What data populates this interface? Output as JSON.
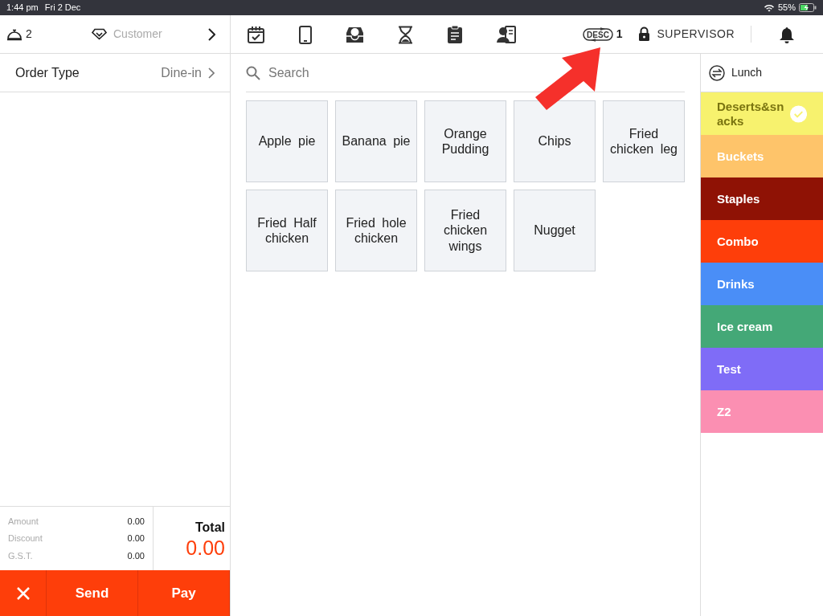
{
  "status_bar": {
    "time": "1:44 pm",
    "date": "Fri 2 Dec",
    "battery": "55%"
  },
  "header": {
    "table_count": "2",
    "customer": "Customer",
    "desc_label": "DESC",
    "desc_count": "1",
    "user": "SUPERVISOR"
  },
  "order": {
    "label": "Order Type",
    "value": "Dine-in"
  },
  "search": {
    "placeholder": "Search"
  },
  "items": [
    {
      "name": "Apple pie"
    },
    {
      "name": "Banana pie"
    },
    {
      "name": "Orange Pudding"
    },
    {
      "name": "Chips"
    },
    {
      "name": "Fried chicken leg"
    },
    {
      "name": "Fried Half chicken"
    },
    {
      "name": "Fried hole chicken"
    },
    {
      "name": "Fried chicken wings"
    },
    {
      "name": "Nugget"
    }
  ],
  "menu": {
    "name": "Lunch"
  },
  "categories": [
    {
      "name": "Deserts&snacks",
      "color": "#f7f26e",
      "selected": true
    },
    {
      "name": "Buckets",
      "color": "#fec46a",
      "selected": false
    },
    {
      "name": "Staples",
      "color": "#8f1205",
      "selected": false
    },
    {
      "name": "Combo",
      "color": "#fe3e0a",
      "selected": false
    },
    {
      "name": "Drinks",
      "color": "#4a8ef7",
      "selected": false
    },
    {
      "name": "Ice cream",
      "color": "#44a877",
      "selected": false
    },
    {
      "name": "Test",
      "color": "#7f6cf7",
      "selected": false
    },
    {
      "name": "Z2",
      "color": "#fb8fb2",
      "selected": false
    }
  ],
  "totals": [
    {
      "label": "Amount",
      "value": "0.00"
    },
    {
      "label": "Discount",
      "value": "0.00"
    },
    {
      "label": "G.S.T.",
      "value": "0.00"
    }
  ],
  "total": {
    "label": "Total",
    "value": "0.00"
  },
  "actions": [
    {
      "kind": "cancel"
    },
    {
      "kind": "text",
      "label": "Send"
    },
    {
      "kind": "text",
      "label": "Pay"
    }
  ]
}
